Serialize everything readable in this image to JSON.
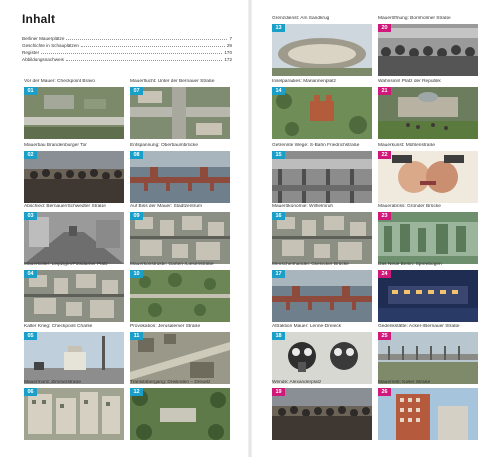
{
  "toc": {
    "title": "Inhalt",
    "entries": [
      {
        "label": "Berliner Mauerplätze",
        "page": "7"
      },
      {
        "label": "Geschichte in Schauplätzen",
        "page": "29"
      },
      {
        "label": "Register",
        "page": "170"
      },
      {
        "label": "Abbildungsnachweis",
        "page": "172"
      }
    ]
  },
  "colors": {
    "blue_badge": "#1aa0c8",
    "pink_badge": "#d0187a"
  },
  "places": [
    {
      "num": "01",
      "caption": "Vor der Mauer: Checkpoint Bravo",
      "badge": "blue",
      "scene": "aerial-highway"
    },
    {
      "num": "02",
      "caption": "Mauerbau Brandenburger Tor",
      "badge": "blue",
      "scene": "crowd"
    },
    {
      "num": "03",
      "caption": "Abschied: Bernauer/Schwedter Straße",
      "badge": "blue",
      "scene": "bw-street"
    },
    {
      "num": "04",
      "caption": "Mauerkoller: Leipziger/Potsdamer Platz",
      "badge": "blue",
      "scene": "city-aerial"
    },
    {
      "num": "05",
      "caption": "Kalter Krieg: Checkpoint Charlie",
      "badge": "blue",
      "scene": "checkpoint"
    },
    {
      "num": "06",
      "caption": "Mauermord: Zimmerstraße",
      "badge": "blue",
      "scene": "facade"
    },
    {
      "num": "07",
      "caption": "Mauerflucht: Unter der Bernauer Straße",
      "badge": "blue",
      "scene": "bridge-road"
    },
    {
      "num": "08",
      "caption": "Entspannung: Oberbaumbrücke",
      "badge": "blue",
      "scene": "bridge-river"
    },
    {
      "num": "09",
      "caption": "Auf Biss der Mauer: Stadtzentrum",
      "badge": "blue",
      "scene": "city-aerial"
    },
    {
      "num": "10",
      "caption": "Mauerkonstrukte: Garten-/Liesenstraße",
      "badge": "blue",
      "scene": "green-aerial"
    },
    {
      "num": "11",
      "caption": "Provokation: Jerusalemer Straße",
      "badge": "blue",
      "scene": "street-aerial"
    },
    {
      "num": "12",
      "caption": "Transitübergang: Dreilinden – Drewitz",
      "badge": "blue",
      "scene": "trees-aerial"
    },
    {
      "num": "13",
      "caption": "Grenzdienst: Am Sandkrug",
      "badge": "blue",
      "scene": "stadium"
    },
    {
      "num": "14",
      "caption": "Inselparadies: Mariannenplatz",
      "badge": "blue",
      "scene": "park"
    },
    {
      "num": "15",
      "caption": "Getrennte Wege: S-Bahn Friedrichstraße",
      "badge": "blue",
      "scene": "bw-station"
    },
    {
      "num": "16",
      "caption": "Mauerökonomie: Wilhelmruh",
      "badge": "blue",
      "scene": "city-aerial"
    },
    {
      "num": "17",
      "caption": "Menschenhandel: Glienicker Brücke",
      "badge": "blue",
      "scene": "bridge-river"
    },
    {
      "num": "18",
      "caption": "Attraktion Mauer: Lenné-Dreieck",
      "badge": "blue",
      "scene": "gasmask"
    },
    {
      "num": "19",
      "caption": "Wende: Alexanderplatz",
      "badge": "pink",
      "scene": "crowd"
    },
    {
      "num": "20",
      "caption": "Maueröffnung: Bornholmer Straße",
      "badge": "pink",
      "scene": "bw-crowd"
    },
    {
      "num": "21",
      "caption": "Wahnsinn! Platz der Republik",
      "badge": "pink",
      "scene": "reichstag"
    },
    {
      "num": "22",
      "caption": "Mauerkunst: Mühlenstraße",
      "badge": "pink",
      "scene": "kiss"
    },
    {
      "num": "23",
      "caption": "Mauerabriss: Gründer Brücke",
      "badge": "pink",
      "scene": "graffiti"
    },
    {
      "num": "24",
      "caption": "Das Neue Berlin: Spreebogen",
      "badge": "pink",
      "scene": "night"
    },
    {
      "num": "25",
      "caption": "Gedenkstätte: Acker-/Bernauer Straße",
      "badge": "pink",
      "scene": "memorial"
    },
    {
      "num": "26",
      "caption": "Mauerrest: Kieler Straße",
      "badge": "pink",
      "scene": "tower"
    }
  ]
}
